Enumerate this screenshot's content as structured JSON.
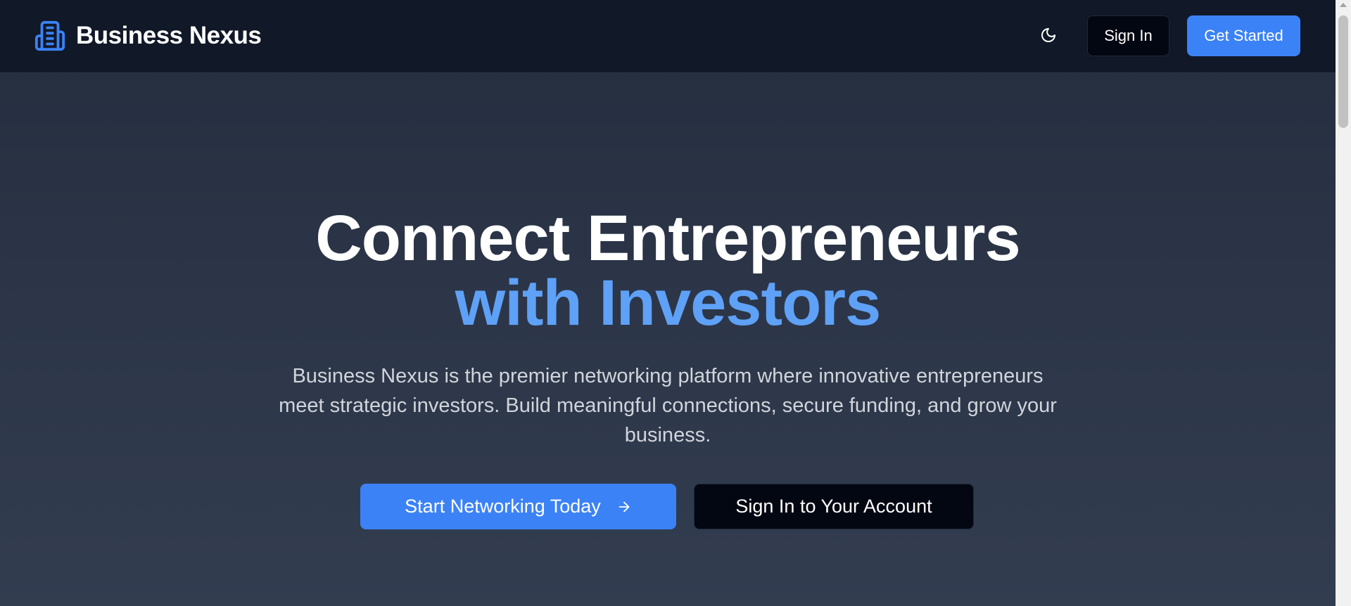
{
  "header": {
    "brand_name": "Business Nexus",
    "brand_icon": "building-icon",
    "theme_toggle_icon": "moon-icon",
    "sign_in_label": "Sign In",
    "get_started_label": "Get Started"
  },
  "hero": {
    "title_line1": "Connect Entrepreneurs",
    "title_line2": "with Investors",
    "subtitle": "Business Nexus is the premier networking platform where innovative entrepreneurs meet strategic investors. Build meaningful connections, secure funding, and grow your business.",
    "primary_cta_label": "Start Networking Today",
    "primary_cta_icon": "arrow-right-icon",
    "secondary_cta_label": "Sign In to Your Account"
  },
  "colors": {
    "header_bg": "#111827",
    "accent": "#3b82f6",
    "title_accent": "#5ea1f7",
    "dark_button": "#030712",
    "body_text": "#d1d5db"
  }
}
